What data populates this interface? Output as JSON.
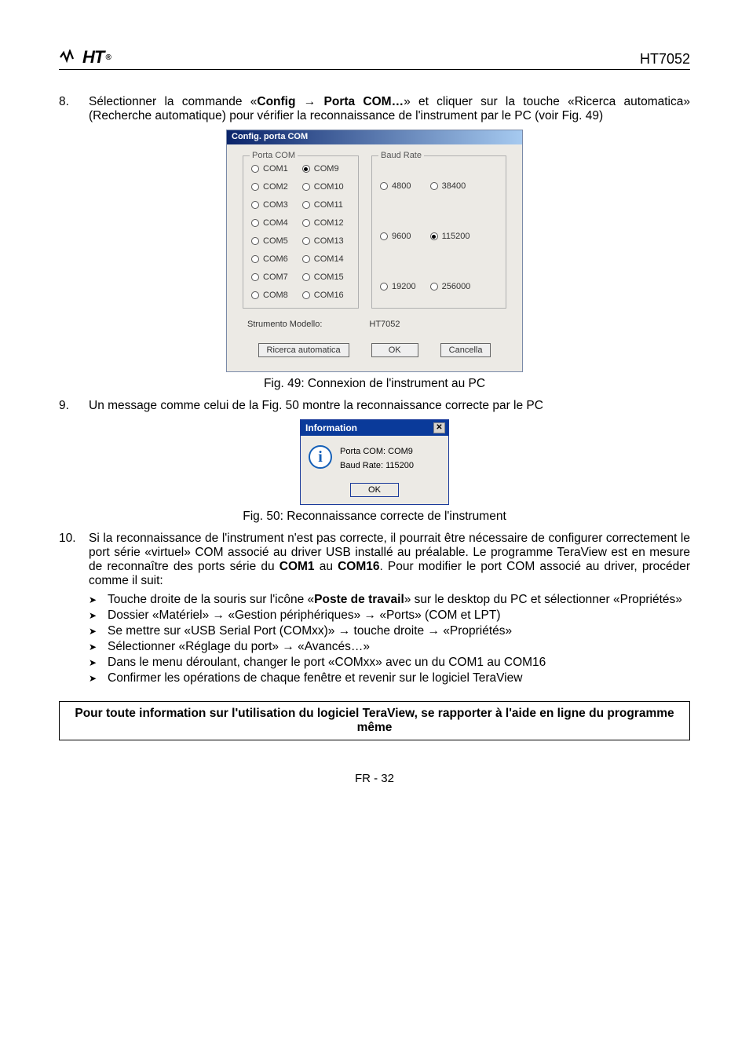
{
  "header": {
    "logo_text": "HT",
    "right": "HT7052"
  },
  "items": {
    "n8": {
      "num": "8.",
      "text_parts": {
        "p1": "Sélectionner la commande «",
        "bold_config": "Config",
        "arrow": " → ",
        "bold_porta": "Porta COM…",
        "p2": "» et cliquer sur la touche «Ricerca automatica» (Recherche automatique) pour vérifier la reconnaissance de l'instrument par le PC (voir Fig. 49)"
      }
    },
    "n9": {
      "num": "9.",
      "text": "Un message comme celui de la Fig. 50 montre la reconnaissance correcte par le PC"
    },
    "n10": {
      "num": "10.",
      "text_parts": {
        "p1": "Si la reconnaissance de l'instrument n'est pas correcte, il pourrait être nécessaire de configurer correctement le port série «virtuel» COM associé au driver USB installé au préalable. Le programme TeraView est en mesure de reconnaître des ports série du ",
        "b1": "COM1",
        "p2": " au ",
        "b2": "COM16",
        "p3": ". Pour modifier le port COM associé au driver, procéder comme il suit:"
      }
    }
  },
  "sublist": {
    "s1": {
      "p1": "Touche droite de la souris sur l'icône «",
      "b": "Poste de travail",
      "p2": "» sur le desktop du PC et sélectionner «Propriétés»"
    },
    "s2": "Dossier «Matériel» → «Gestion périphériques» → «Ports» (COM et LPT)",
    "s3": "Se mettre sur «USB Serial Port (COMxx)» → touche droite → «Propriétés»",
    "s4": "Sélectionner «Réglage du port» → «Avancés…»",
    "s5": "Dans le menu déroulant, changer le port «COMxx» avec un du COM1 au COM16",
    "s6": "Confirmer les opérations de chaque fenêtre et revenir sur le logiciel TeraView"
  },
  "dlg1": {
    "title": "Config. porta COM",
    "legend_porta": "Porta COM",
    "legend_baud": "Baud Rate",
    "porta_left": [
      "COM1",
      "COM2",
      "COM3",
      "COM4",
      "COM5",
      "COM6",
      "COM7",
      "COM8"
    ],
    "porta_right": [
      "COM9",
      "COM10",
      "COM11",
      "COM12",
      "COM13",
      "COM14",
      "COM15",
      "COM16"
    ],
    "porta_selected": "COM9",
    "baud_left": [
      "4800",
      "9600",
      "19200"
    ],
    "baud_right": [
      "38400",
      "115200",
      "256000"
    ],
    "baud_selected": "115200",
    "modello_label": "Strumento Modello:",
    "modello_value": "HT7052",
    "btn_ricerca": "Ricerca automatica",
    "btn_ok": "OK",
    "btn_cancel": "Cancella"
  },
  "captions": {
    "fig49": "Fig. 49: Connexion de l'instrument au PC",
    "fig50": "Fig. 50: Reconnaissance correcte de l'instrument"
  },
  "dlg2": {
    "title": "Information",
    "line1": "Porta COM:  COM9",
    "line2": "Baud Rate:  115200",
    "ok": "OK"
  },
  "note": "Pour toute information sur l'utilisation du logiciel TeraView, se rapporter à l'aide en ligne du programme même",
  "footer": "FR - 32"
}
